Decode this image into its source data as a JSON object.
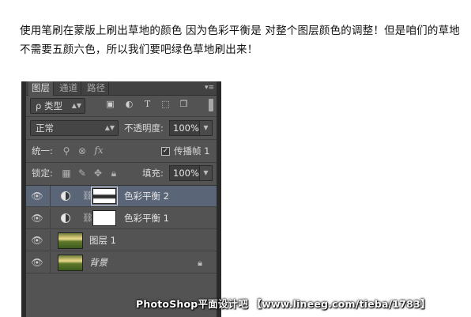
{
  "article": {
    "line1": "使用笔刷在蒙版上刷出草地的颜色 因为色彩平衡是 对整个图层颜色的调整！但是咱们的草地",
    "line2": "不需要五颜六色，所以我们要吧绿色草地刷出来！"
  },
  "panel": {
    "tabs": [
      "图层",
      "通道",
      "路径"
    ],
    "menu_icon": "panel-menu-icon",
    "filter": {
      "label": "ρ 类型",
      "icons": [
        "image-filter-icon",
        "adjustment-filter-icon",
        "type-filter-icon",
        "shape-filter-icon",
        "smart-object-filter-icon"
      ]
    },
    "blend_mode": "正常",
    "opacity_label": "不透明度:",
    "opacity_value": "100%",
    "unify_label": "统一:",
    "propagate_label": "传播帧 1",
    "propagate_checked": true,
    "lock_label": "锁定:",
    "fill_label": "填充:",
    "fill_value": "100%"
  },
  "layers": [
    {
      "name": "色彩平衡 2",
      "type": "adjustment",
      "selected": true,
      "mask": "dark",
      "visible": true
    },
    {
      "name": "色彩平衡 1",
      "type": "adjustment",
      "selected": false,
      "mask": "light",
      "visible": true
    },
    {
      "name": "图层 1",
      "type": "image",
      "selected": false,
      "visible": true
    },
    {
      "name": "背景",
      "type": "background",
      "selected": false,
      "visible": true,
      "locked": true
    }
  ],
  "watermark": "PhotoShop平面设计吧 【www.lineeg.com/tieba/1783】",
  "colors": {
    "panel_bg": "#535353",
    "selected_layer": "#5a6578",
    "text": "#111111"
  }
}
